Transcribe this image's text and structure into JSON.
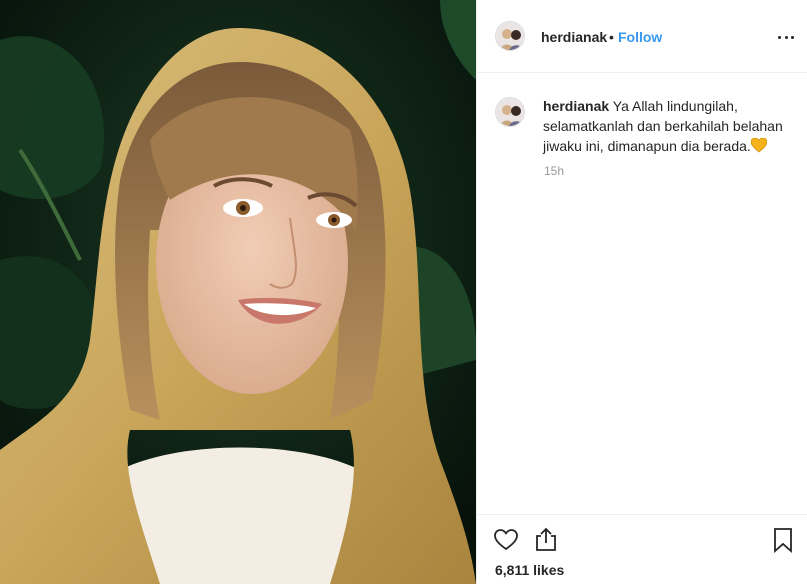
{
  "post": {
    "username": "herdianak",
    "separator": "•",
    "follow_label": "Follow",
    "caption_text": "Ya Allah lindungilah, selamatkanlah dan berkahilah belahan jiwaku ini, dimanapun dia berada.",
    "time_ago": "15h",
    "likes": "6,811 likes"
  },
  "icons": {
    "more": "more-options-icon",
    "like": "heart-outline-icon",
    "share": "share-icon",
    "save": "bookmark-icon",
    "caption_emoji": "yellow-heart-emoji"
  },
  "colors": {
    "link": "#3897f0",
    "text": "#262626",
    "muted": "#999999",
    "divider": "#efefef",
    "emoji_heart": "#f5b21b"
  }
}
